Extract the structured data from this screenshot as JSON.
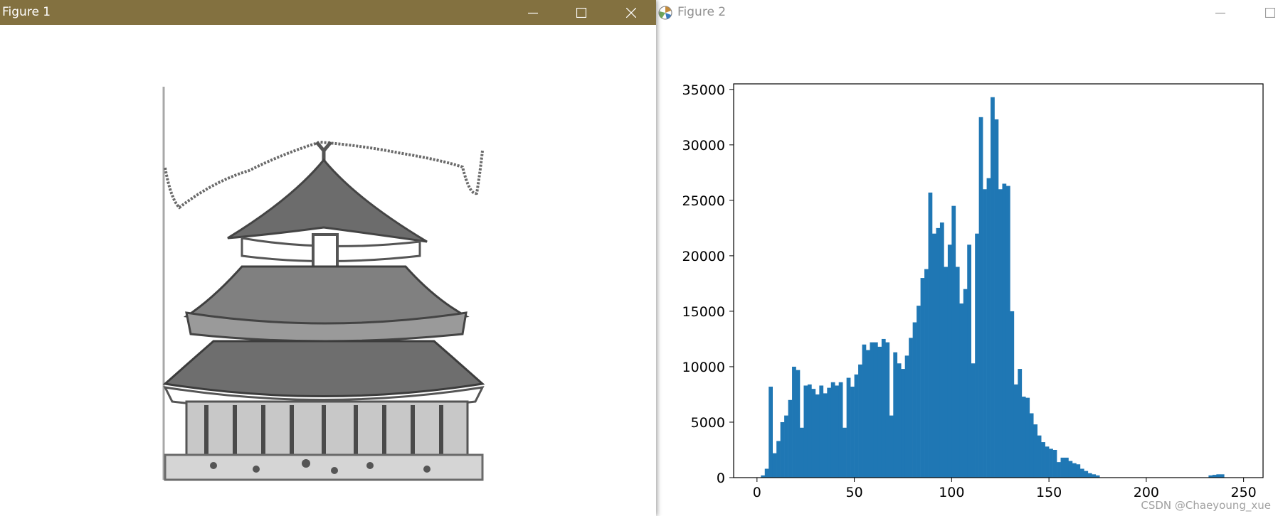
{
  "figure1": {
    "title": "Figure 1",
    "controls": {
      "minimize": "minimize",
      "maximize": "maximize",
      "close": "close"
    },
    "image": {
      "description_icon": "temple-of-heaven-posterized-image"
    }
  },
  "figure2": {
    "title": "Figure 2",
    "controls": {
      "minimize": "minimize",
      "maximize": "maximize"
    }
  },
  "watermark": "CSDN @Chaeyoung_xue",
  "colors": {
    "fig1_titlebar": "#837140",
    "bar": "#1f77b4"
  },
  "chart_data": {
    "type": "bar",
    "title": "",
    "xlabel": "",
    "ylabel": "",
    "xlim": [
      -12,
      260
    ],
    "ylim": [
      0,
      35500
    ],
    "xticks": [
      0,
      50,
      100,
      150,
      200,
      250
    ],
    "yticks": [
      0,
      5000,
      10000,
      15000,
      20000,
      25000,
      30000,
      35000
    ],
    "bin_width": 2,
    "bin_start": 0,
    "values": [
      0,
      200,
      800,
      8200,
      2200,
      3300,
      5000,
      5600,
      7000,
      10000,
      9700,
      4500,
      8300,
      8400,
      8000,
      7500,
      8300,
      7600,
      8100,
      8600,
      8300,
      8600,
      4500,
      9000,
      8200,
      9300,
      10200,
      12000,
      11500,
      12200,
      12200,
      11800,
      12500,
      12200,
      5600,
      11300,
      10300,
      9800,
      11000,
      12600,
      14000,
      15500,
      18000,
      18800,
      25700,
      22000,
      22500,
      23000,
      19000,
      21000,
      24500,
      19000,
      15700,
      17000,
      21000,
      10300,
      22000,
      32500,
      26000,
      27000,
      34300,
      32300,
      26000,
      26500,
      26300,
      15000,
      8400,
      9800,
      7300,
      7200,
      5800,
      4800,
      3800,
      3200,
      2800,
      2600,
      2500,
      1400,
      1800,
      1800,
      1500,
      1300,
      1200,
      800,
      600,
      400,
      300,
      200,
      0,
      0,
      0,
      0,
      0,
      0,
      0,
      0,
      0,
      0,
      0,
      0,
      0,
      0,
      0,
      0,
      0,
      0,
      0,
      0,
      0,
      0,
      0,
      0,
      0,
      0,
      0,
      0,
      200,
      250,
      300,
      300
    ]
  }
}
